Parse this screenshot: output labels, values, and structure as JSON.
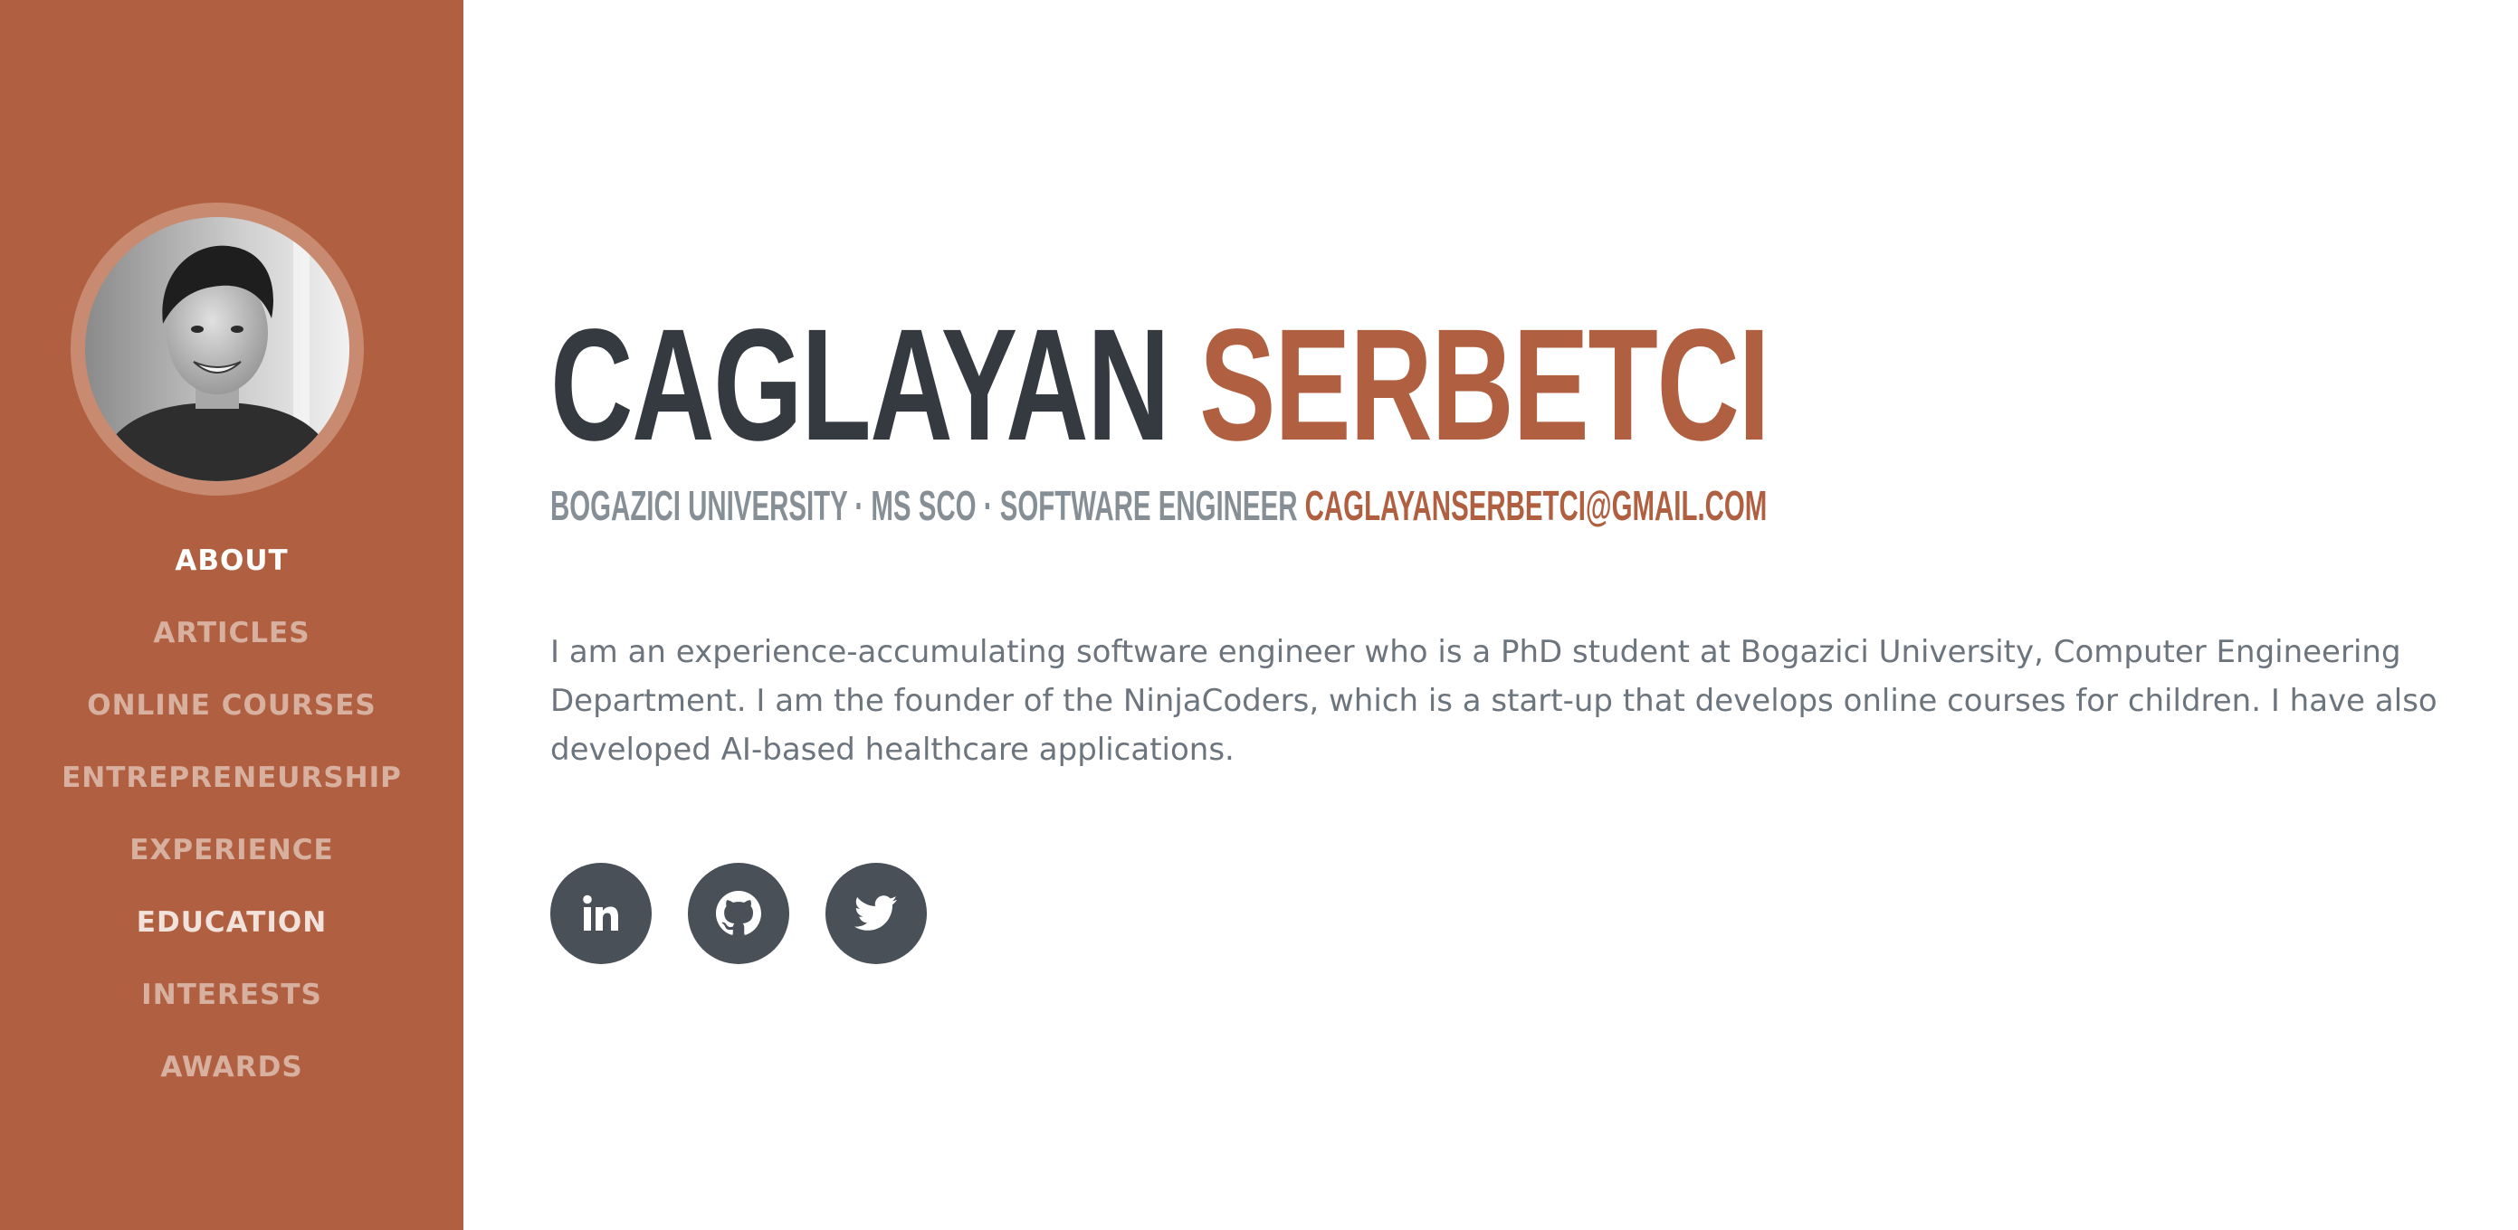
{
  "profile": {
    "first_name": "CAGLAYAN",
    "last_name": "SERBETCI",
    "subheading": "BOGAZICI UNIVERSITY · MS SCO · SOFTWARE ENGINEER",
    "email": "CAGLAYANSERBETCI@GMAIL.COM",
    "bio": "I am an experience-accumulating software engineer who is a PhD student at Bogazici University, Computer Engineering Department. I am the founder of the NinjaCoders, which is a start-up that develops online courses for children. I have also developed AI-based healthcare applications."
  },
  "sidebar": {
    "items": [
      {
        "label": "ABOUT"
      },
      {
        "label": "ARTICLES"
      },
      {
        "label": "ONLINE COURSES"
      },
      {
        "label": "ENTREPRENEURSHIP"
      },
      {
        "label": "EXPERIENCE"
      },
      {
        "label": "EDUCATION"
      },
      {
        "label": "INTERESTS"
      },
      {
        "label": "AWARDS"
      }
    ]
  },
  "social": [
    {
      "icon": "linkedin-icon"
    },
    {
      "icon": "github-icon"
    },
    {
      "icon": "twitter-icon"
    }
  ],
  "colors": {
    "sidebar_bg": "#b06040",
    "accent": "#b06040",
    "heading": "#343a40",
    "subheading": "#868e96",
    "body_text": "#6c757d",
    "social_bg": "#495057"
  }
}
